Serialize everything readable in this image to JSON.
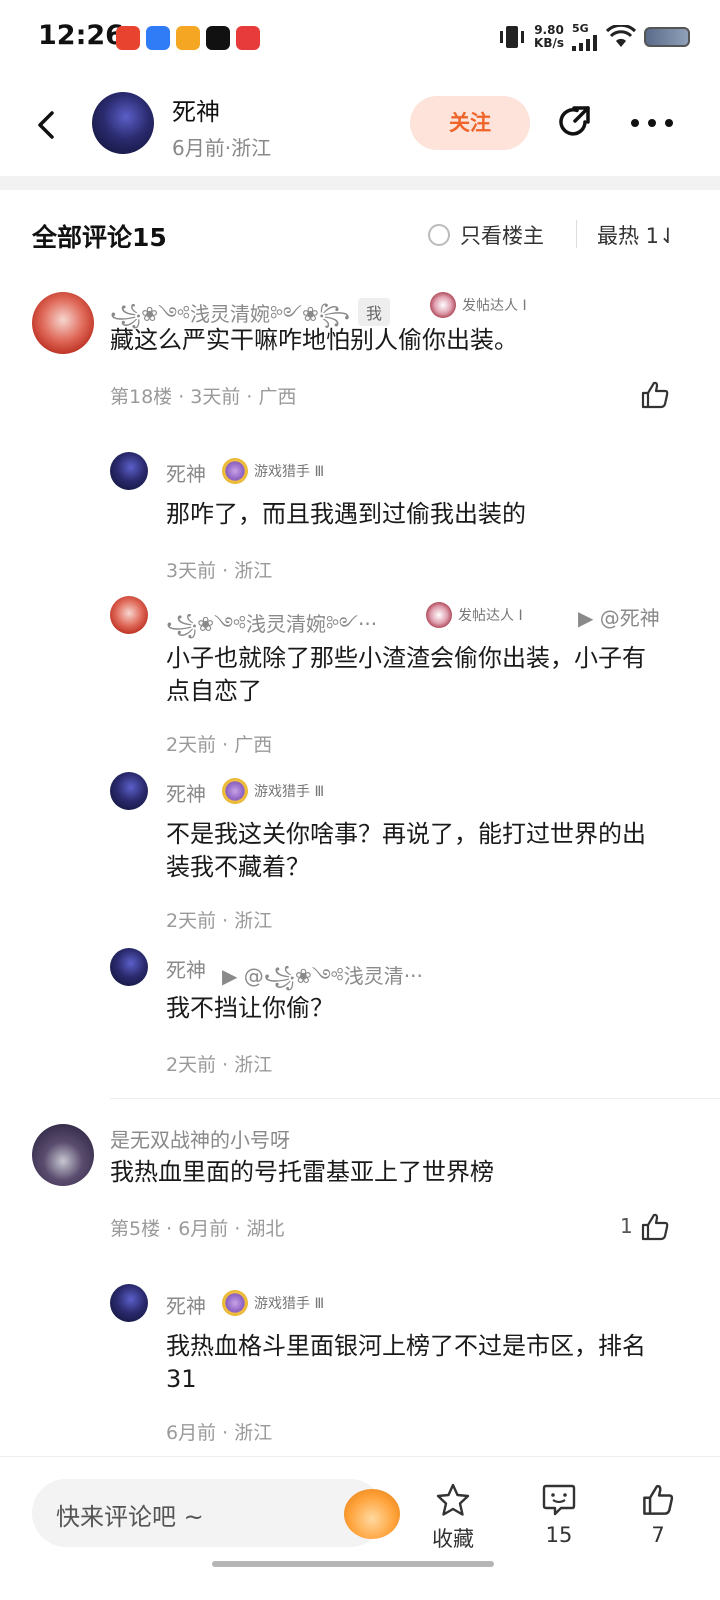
{
  "status_bar": {
    "time": "12:26",
    "net_speed_value": "9.80",
    "net_speed_unit": "KB/s",
    "network": "5G",
    "app_colors": [
      "#e8432f",
      "#2f7cf6",
      "#f5a623",
      "#111111",
      "#e73a3a"
    ]
  },
  "header": {
    "author_name": "死神",
    "author_meta": "6月前·浙江",
    "follow_label": "关注"
  },
  "comments_header": {
    "title": "全部评论15",
    "op_only_label": "只看楼主",
    "sort_label": "最热 1⇃"
  },
  "comments": [
    {
      "name": "꧁❀༺浅灵清婉༻❀꧂",
      "is_me_badge": "我",
      "badge": "发帖达人 Ⅰ",
      "text": "藏这么严实干嘛咋地怕别人偷你出装。",
      "meta": "第18楼 · 3天前 · 广西",
      "replies": [
        {
          "name": "死神",
          "badge": "游戏猎手 Ⅲ",
          "text": "那咋了，而且我遇到过偷我出装的",
          "meta": "3天前 · 浙江"
        },
        {
          "name": "꧁❀༺浅灵清婉༻···",
          "badge": "发帖达人 Ⅰ",
          "reply_to": "▶ @死神",
          "text": "小子也就除了那些小渣渣会偷你出装，小子有点自恋了",
          "meta": "2天前 · 广西"
        },
        {
          "name": "死神",
          "badge": "游戏猎手 Ⅲ",
          "text": "不是我这关你啥事？再说了，能打过世界的出装我不藏着？",
          "meta": "2天前 · 浙江"
        },
        {
          "name": "死神",
          "reply_to": "▶ @꧁❀༺浅灵清···",
          "text": "我不挡让你偷？",
          "meta": "2天前 · 浙江"
        }
      ]
    },
    {
      "name": "是无双战神的小号呀",
      "text": "我热血里面的号托雷基亚上了世界榜",
      "meta": "第5楼 · 6月前 · 湖北",
      "likes": "1",
      "replies": [
        {
          "name": "死神",
          "badge": "游戏猎手 Ⅲ",
          "text": "我热血格斗里面银河上榜了不过是市区，排名31",
          "meta": "6月前 · 浙江"
        }
      ]
    }
  ],
  "bottom_bar": {
    "input_placeholder": "快来评论吧 ~",
    "collect_label": "收藏",
    "comment_count": "15",
    "like_count": "7"
  },
  "colors": {
    "accent": "#f0642a",
    "follow_bg": "#fde3d9",
    "meta_gray": "#9a9a9a"
  }
}
